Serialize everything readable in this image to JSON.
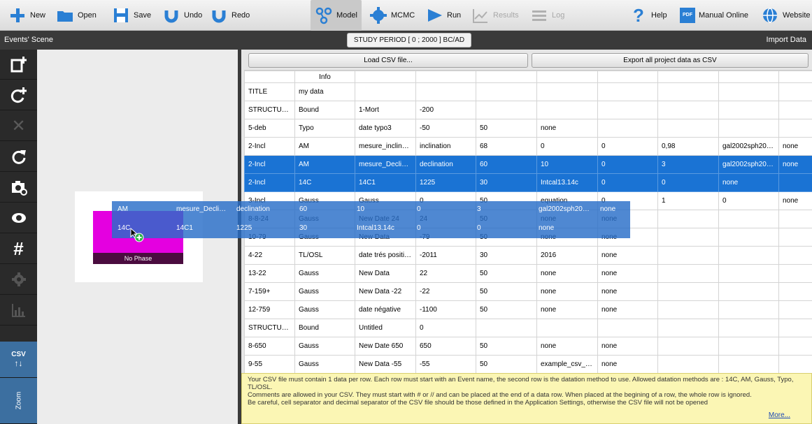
{
  "toolbar": {
    "new": "New",
    "open": "Open",
    "save": "Save",
    "undo": "Undo",
    "redo": "Redo",
    "model": "Model",
    "mcmc": "MCMC",
    "run": "Run",
    "results": "Results",
    "log": "Log",
    "help": "Help",
    "manual": "Manual Online",
    "website": "Website",
    "pdf_badge": "PDF"
  },
  "header": {
    "scene_title": "Events' Scene",
    "study_period": "STUDY PERIOD [ 0 ; 2000 ] BC/AD",
    "import": "Import Data"
  },
  "sidebar": {
    "csv": "CSV",
    "zoom": "Zoom"
  },
  "scene": {
    "phase_label": "No Phase"
  },
  "buttons": {
    "load_csv": "Load CSV file...",
    "export_csv": "Export all project data as CSV"
  },
  "table": {
    "header": [
      "",
      "Info",
      "",
      "",
      "",
      "",
      "",
      "",
      "",
      ""
    ],
    "rows": [
      [
        "TITLE",
        "my data",
        "",
        "",
        "",
        "",
        "",
        "",
        "",
        ""
      ],
      [
        "STRUCTURE",
        "Bound",
        "1-Mort",
        "-200",
        "",
        "",
        "",
        "",
        "",
        ""
      ],
      [
        "5-deb",
        "Typo",
        "date typo3",
        "-50",
        "50",
        "none",
        "",
        "",
        "",
        ""
      ],
      [
        "2-Incl",
        "AM",
        "mesure_inclin…",
        "inclination",
        "68",
        "0",
        "0",
        "0,98",
        "gal2002sph20…",
        "none"
      ],
      [
        "2-Incl",
        "AM",
        "mesure_Decli…",
        "declination",
        "60",
        "10",
        "0",
        "3",
        "gal2002sph20…",
        "none"
      ],
      [
        "2-Incl",
        "14C",
        "14C1",
        "1225",
        "30",
        "Intcal13.14c",
        "0",
        "0",
        "none",
        ""
      ],
      [
        "3-Incl",
        "Gauss",
        "Gauss",
        "0",
        "50",
        "equation",
        "0",
        "1",
        "0",
        "none"
      ],
      [
        "8-8-24",
        "Gauss",
        "New Date 24",
        "24",
        "50",
        "none",
        "none",
        "",
        "",
        ""
      ],
      [
        "10-79",
        "Gauss",
        "New Data",
        "-79",
        "50",
        "none",
        "none",
        "",
        "",
        ""
      ],
      [
        "4-22",
        "TL/OSL",
        "date trés positive+",
        "-2011",
        "30",
        "2016",
        "none",
        "",
        "",
        ""
      ],
      [
        "13-22",
        "Gauss",
        "New Data",
        "22",
        "50",
        "none",
        "none",
        "",
        "",
        ""
      ],
      [
        "7-159+",
        "Gauss",
        "New Data -22",
        "-22",
        "50",
        "none",
        "none",
        "",
        "",
        ""
      ],
      [
        "12-759",
        "Gauss",
        "date négative",
        "-1100",
        "50",
        "none",
        "none",
        "",
        "",
        ""
      ],
      [
        "STRUCTURE",
        "Bound",
        "Untitled",
        "0",
        "",
        "",
        "",
        "",
        "",
        ""
      ],
      [
        "8-650",
        "Gauss",
        "New Date 650",
        "650",
        "50",
        "none",
        "none",
        "",
        "",
        ""
      ],
      [
        "9-55",
        "Gauss",
        "New Data -55",
        "-55",
        "50",
        "example_csv_…",
        "none",
        "",
        "",
        ""
      ]
    ]
  },
  "drag": {
    "row1": [
      "AM",
      "mesure_Decli…",
      "declination",
      "60",
      "10",
      "0",
      "3",
      "gal2002sph20…",
      "none"
    ],
    "row2": [
      "14C",
      "14C1",
      "1225",
      "30",
      "Intcal13.14c",
      "0",
      "0",
      "none"
    ]
  },
  "info_text": "Your CSV file must contain 1 data per row. Each row must start with an Event name, the second row is the datation method to use. Allowed datation methods are : 14C, AM, Gauss, Typo, TL/OSL.\nComments are allowed in your CSV. They must start with  # or // and can be placed at the end of a data row. When placed at the begining of a row, the whole row is ignored.\nBe careful, cell separator and decimal separator of the CSV file should be those defined in the Application Settings, otherwise the CSV file will not be opened",
  "more_link": "More...",
  "colors": {
    "selection": "#1a73d4",
    "magenta": "#e400e0",
    "info_bg": "#fbf6b4"
  }
}
